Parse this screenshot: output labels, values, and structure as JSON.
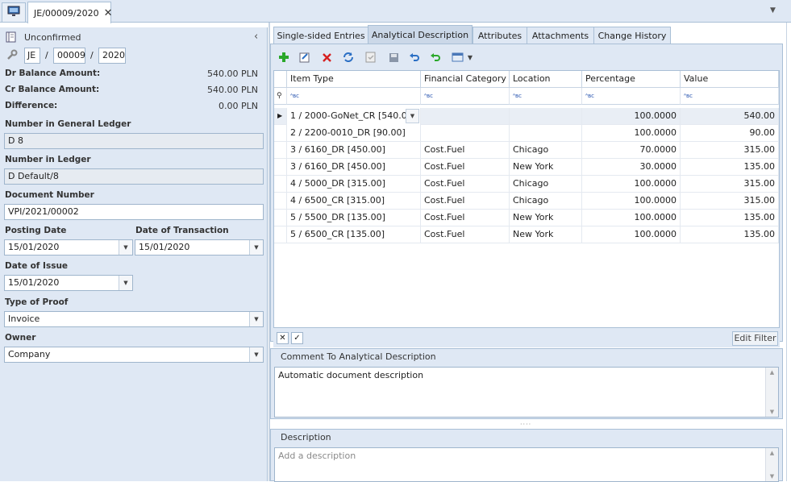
{
  "tabs": {
    "doc_tab_title": "JE/00009/2020"
  },
  "left": {
    "status": "Unconfirmed",
    "series": "JE",
    "number": "00009",
    "year": "2020",
    "sep1": "/",
    "sep2": "/",
    "dr_label": "Dr Balance Amount:",
    "dr_value": "540.00 PLN",
    "cr_label": "Cr Balance Amount:",
    "cr_value": "540.00 PLN",
    "diff_label": "Difference:",
    "diff_value": "0.00 PLN",
    "gl_label": "Number in General Ledger",
    "gl_value": "D 8",
    "ledger_label": "Number in Ledger",
    "ledger_value": "D Default/8",
    "docnum_label": "Document Number",
    "docnum_value": "VPI/2021/00002",
    "posting_label": "Posting Date",
    "posting_value": "15/01/2020",
    "transaction_label": "Date of Transaction",
    "transaction_value": "15/01/2020",
    "issue_label": "Date of Issue",
    "issue_value": "15/01/2020",
    "proof_label": "Type of Proof",
    "proof_value": "Invoice",
    "owner_label": "Owner",
    "owner_value": "Company"
  },
  "right_tabs": [
    "Single-sided Entries",
    "Analytical Description",
    "Attributes",
    "Attachments",
    "Change History"
  ],
  "grid": {
    "columns": [
      "Item Type",
      "Financial Category",
      "Location",
      "Percentage",
      "Value"
    ],
    "filter_glyph": "ᴬʙᴄ",
    "rows": [
      [
        "1 / 2000-GoNet_CR [540.00]",
        "",
        "",
        "100.0000",
        "540.00"
      ],
      [
        "2 / 2200-0010_DR [90.00]",
        "",
        "",
        "100.0000",
        "90.00"
      ],
      [
        "3 / 6160_DR [450.00]",
        "Cost.Fuel",
        "Chicago",
        "70.0000",
        "315.00"
      ],
      [
        "3 / 6160_DR [450.00]",
        "Cost.Fuel",
        "New York",
        "30.0000",
        "135.00"
      ],
      [
        "4 / 5000_DR [315.00]",
        "Cost.Fuel",
        "Chicago",
        "100.0000",
        "315.00"
      ],
      [
        "4 / 6500_CR [315.00]",
        "Cost.Fuel",
        "Chicago",
        "100.0000",
        "315.00"
      ],
      [
        "5 / 5500_DR [135.00]",
        "Cost.Fuel",
        "New York",
        "100.0000",
        "135.00"
      ],
      [
        "5 / 6500_CR [135.00]",
        "Cost.Fuel",
        "New York",
        "100.0000",
        "135.00"
      ]
    ],
    "edit_filter": "Edit Filter"
  },
  "comment": {
    "label": "Comment To Analytical Description",
    "value": "Automatic document description"
  },
  "description": {
    "label": "Description",
    "placeholder": "Add a description"
  },
  "colors": {
    "panel_bg": "#dfe8f4",
    "border": "#a9bfd6",
    "accent_green": "#2aa82a",
    "accent_red": "#d62020",
    "accent_blue": "#2b6fc4"
  }
}
